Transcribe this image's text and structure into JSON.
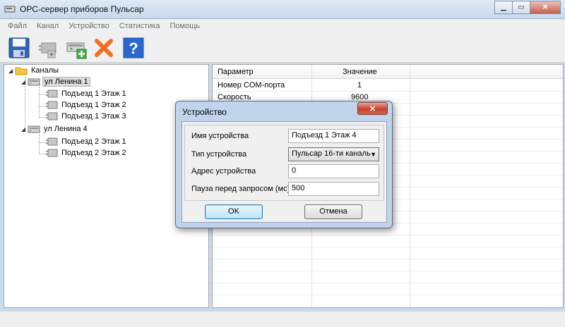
{
  "window": {
    "title": "ОРС-сервер приборов Пульсар",
    "minimize_glyph": "▁",
    "maximize_glyph": "▭",
    "close_glyph": "✕"
  },
  "menu": {
    "items": [
      "Файл",
      "Канал",
      "Устройство",
      "Статистика",
      "Помощь"
    ]
  },
  "toolbar": {
    "icons": [
      "save-icon",
      "device-plus-icon",
      "channel-plus-icon",
      "delete-icon",
      "help-icon"
    ],
    "help_glyph": "?",
    "delete_glyph": "✖"
  },
  "tree": {
    "root": {
      "label": "Каналы",
      "expander": "◢"
    },
    "channels": [
      {
        "label": "ул Ленина 1",
        "expander": "◢",
        "selected": true,
        "devices": [
          "Подъезд 1 Этаж 1",
          "Подъезд 1 Этаж 2",
          "Подъезд 1 Этаж 3"
        ]
      },
      {
        "label": "ул Ленина 4",
        "expander": "◢",
        "selected": false,
        "devices": [
          "Подъезд 2 Этаж 1",
          "Подъезд 2 Этаж 2"
        ]
      }
    ]
  },
  "grid": {
    "columns": [
      "Параметр",
      "Значение"
    ],
    "rows": [
      {
        "param": "Номер COM-порта",
        "value": "1"
      },
      {
        "param": "Скорость",
        "value": "9600"
      }
    ]
  },
  "dialog": {
    "title": "Устройство",
    "close_glyph": "✕",
    "fields": {
      "name": {
        "label": "Имя устройства",
        "value": "Подъезд 1 Этаж 4"
      },
      "type": {
        "label": "Тип устройства",
        "value": "Пульсар 16-ти каналь"
      },
      "address": {
        "label": "Адрес устройства",
        "value": "0"
      },
      "pause": {
        "label": "Пауза перед запросом (мс)",
        "value": "500"
      }
    },
    "ok_label": "OK",
    "cancel_label": "Отмена",
    "select_arrow": "▼"
  }
}
